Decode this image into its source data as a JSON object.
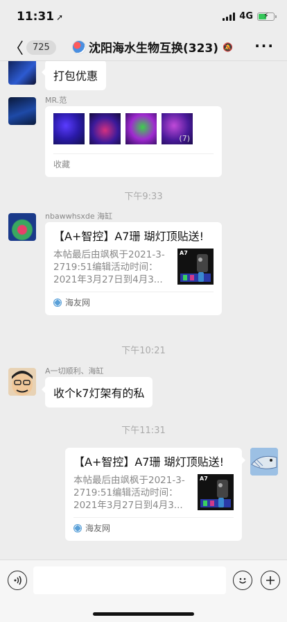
{
  "status_bar": {
    "time": "11:31",
    "network": "4G"
  },
  "nav": {
    "back_count": "725",
    "title": "沈阳海水生物互换(323)"
  },
  "messages": {
    "m1_text": "打包优惠",
    "m2_sender": "MR.范",
    "m2_extra_count": "(7)",
    "m2_fav": "收藏",
    "ts1": "下午9:33",
    "m3_sender": "nbawwhsxde 海缸",
    "m3_title": "【A+智控】A7珊 瑚灯顶贴送!",
    "m3_desc": "本帖最后由飒枫于2021-3-2719:51编辑活动时间：2021年3月27日到4月3...",
    "m3_thumb_label": "A7",
    "m3_source": "海友网",
    "ts2": "下午10:21",
    "m4_sender": "A一切顺利、海缸",
    "m4_text": "收个k7灯架有的私",
    "ts3": "下午11:31",
    "m5_title": "【A+智控】A7珊 瑚灯顶贴送!",
    "m5_desc": "本帖最后由飒枫于2021-3-2719:51编辑活动时间：2021年3月27日到4月3...",
    "m5_thumb_label": "A7",
    "m5_source": "海友网"
  },
  "icons": {
    "back": "chevron-left-icon",
    "more": "more-icon",
    "voice": "voice-icon",
    "emoji": "emoji-icon",
    "add": "add-icon",
    "mute": "bell-off-icon"
  },
  "colors": {
    "background": "#ededed",
    "bubble": "#ffffff",
    "battery": "#34c759"
  }
}
